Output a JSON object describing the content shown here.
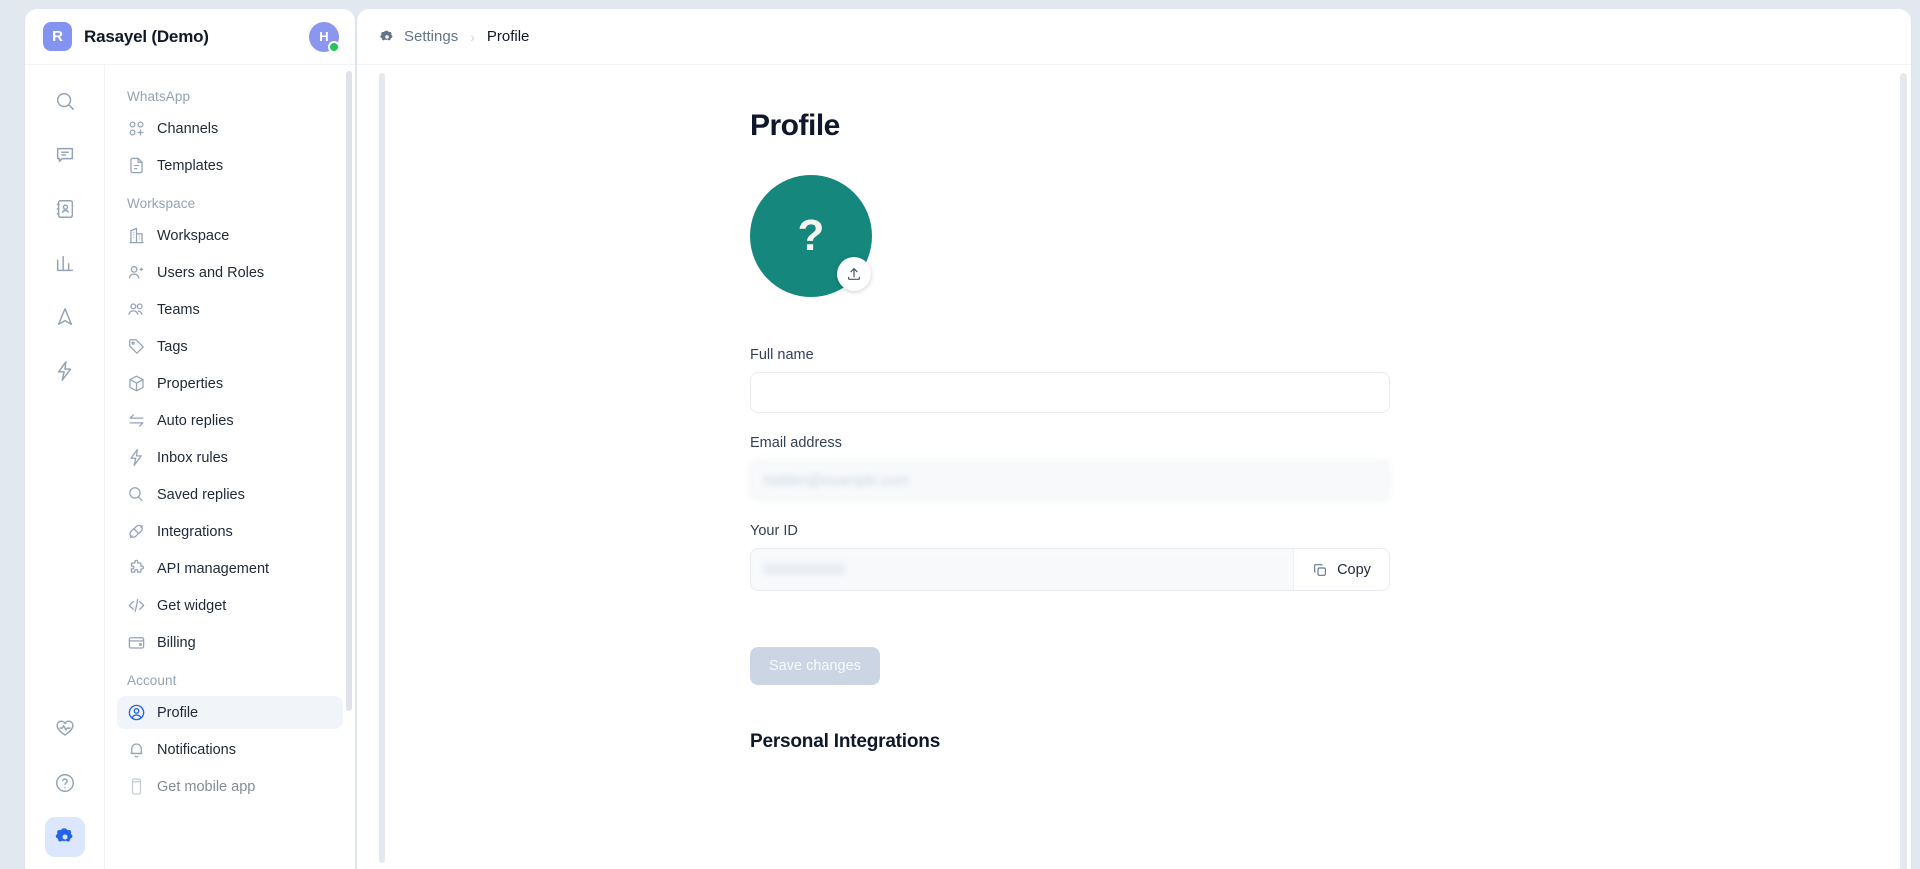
{
  "workspace": {
    "badge_letter": "R",
    "name": "Rasayel (Demo)",
    "avatar_letter": "H"
  },
  "icon_rail": {
    "top": [
      {
        "name": "search-icon",
        "label": "Search"
      },
      {
        "name": "inbox-icon",
        "label": "Inbox"
      },
      {
        "name": "contacts-icon",
        "label": "Contacts"
      },
      {
        "name": "reports-icon",
        "label": "Reports"
      },
      {
        "name": "broadcasts-icon",
        "label": "Broadcasts"
      },
      {
        "name": "automations-icon",
        "label": "Automations"
      }
    ],
    "bottom": [
      {
        "name": "health-icon",
        "label": "Status"
      },
      {
        "name": "help-icon",
        "label": "Help"
      },
      {
        "name": "settings-icon",
        "label": "Settings"
      }
    ]
  },
  "sidebar": {
    "sections": [
      {
        "title": "WhatsApp",
        "items": [
          {
            "label": "Channels",
            "icon": "channels-icon"
          },
          {
            "label": "Templates",
            "icon": "templates-icon"
          }
        ]
      },
      {
        "title": "Workspace",
        "items": [
          {
            "label": "Workspace",
            "icon": "building-icon"
          },
          {
            "label": "Users and Roles",
            "icon": "user-plus-icon"
          },
          {
            "label": "Teams",
            "icon": "users-icon"
          },
          {
            "label": "Tags",
            "icon": "tag-icon"
          },
          {
            "label": "Properties",
            "icon": "cube-icon"
          },
          {
            "label": "Auto replies",
            "icon": "arrows-swap-icon"
          },
          {
            "label": "Inbox rules",
            "icon": "lightning-icon"
          },
          {
            "label": "Saved replies",
            "icon": "chat-bubbles-icon"
          },
          {
            "label": "Integrations",
            "icon": "plug-icon"
          },
          {
            "label": "API management",
            "icon": "puzzle-icon"
          },
          {
            "label": "Get widget",
            "icon": "code-icon"
          },
          {
            "label": "Billing",
            "icon": "wallet-icon"
          }
        ]
      },
      {
        "title": "Account",
        "items": [
          {
            "label": "Profile",
            "icon": "user-circle-icon"
          },
          {
            "label": "Notifications",
            "icon": "bell-icon"
          },
          {
            "label": "Get mobile app",
            "icon": "phone-icon"
          }
        ]
      }
    ]
  },
  "breadcrumb": {
    "icon": "gear-icon",
    "parent": "Settings",
    "separator": "›",
    "current": "Profile"
  },
  "page": {
    "title": "Profile",
    "avatar_placeholder": "?",
    "upload_icon": "upload-icon"
  },
  "form": {
    "full_name": {
      "label": "Full name",
      "value": "",
      "placeholder": ""
    },
    "email": {
      "label": "Email address",
      "value": "hidden@example.com",
      "readonly": true
    },
    "your_id": {
      "label": "Your ID",
      "value": "0000000000",
      "readonly": true,
      "copy_label": "Copy",
      "copy_icon": "copy-icon"
    },
    "save_label": "Save changes",
    "save_disabled": true
  },
  "personal_integrations": {
    "title": "Personal Integrations"
  },
  "colors": {
    "accent": "#2563eb",
    "avatar_big": "#15877c",
    "workspace_badge": "#8293f2",
    "online_dot": "#22c55e",
    "page_bg": "#e2e8f0"
  }
}
